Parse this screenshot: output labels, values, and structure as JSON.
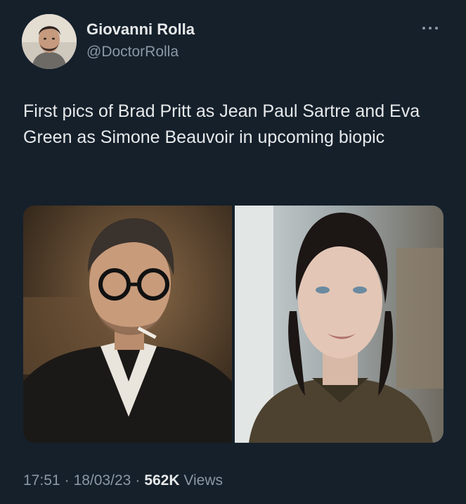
{
  "author": {
    "name": "Giovanni Rolla",
    "handle": "@DoctorRolla"
  },
  "tweet": {
    "text": "First pics of Brad Pritt as Jean Paul Sartre and Eva Green as Simone Beauvoir in upcoming biopic"
  },
  "meta": {
    "time": "17:51",
    "separator": "·",
    "date": "18/03/23",
    "views_count": "562K",
    "views_label": "Views"
  },
  "icons": {
    "more": "more-horizontal-icon"
  },
  "colors": {
    "background": "#15202b",
    "text_primary": "#e7e9ea",
    "text_secondary": "#8b98a5"
  }
}
